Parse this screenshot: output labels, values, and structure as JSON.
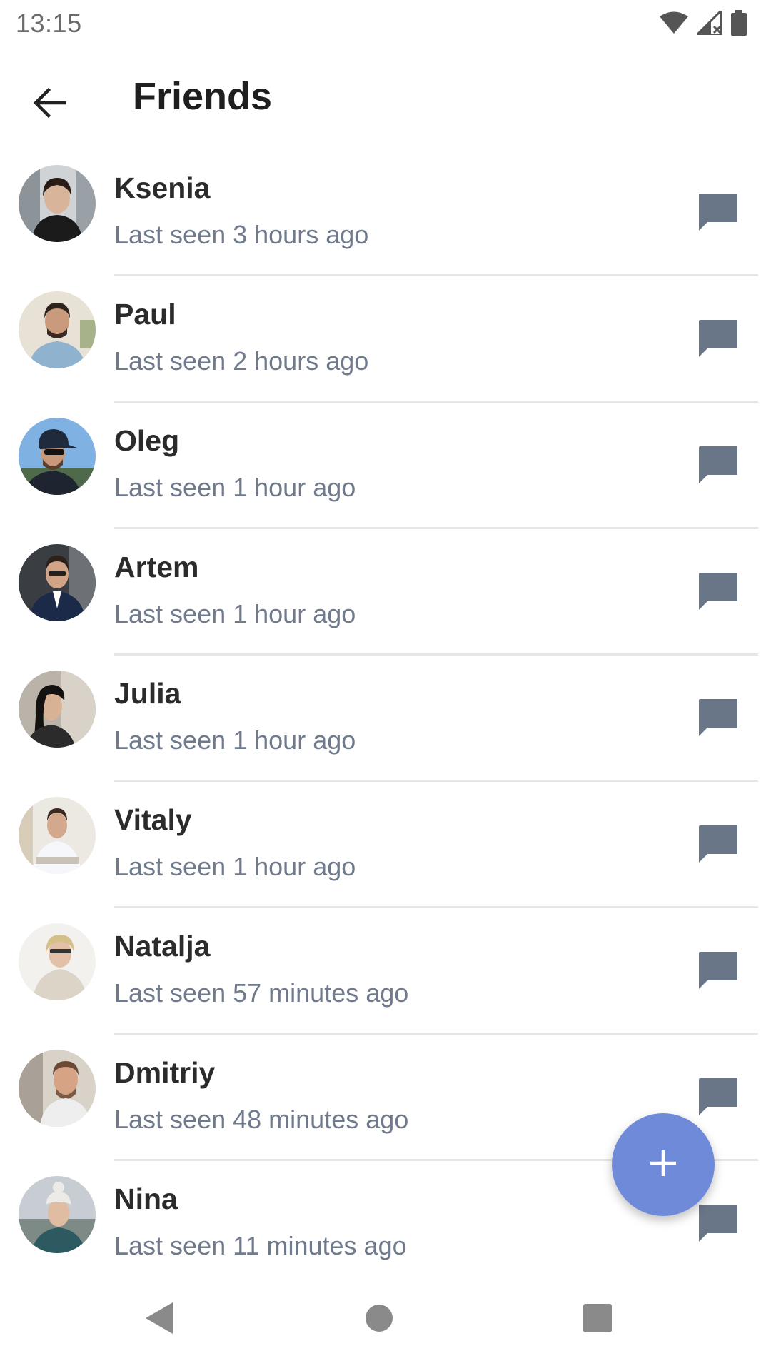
{
  "status_bar": {
    "time": "13:15",
    "icons": [
      "wifi-icon",
      "signal-icon",
      "battery-icon"
    ]
  },
  "app_bar": {
    "back_icon": "arrow-back-icon",
    "title": "Friends"
  },
  "friends": [
    {
      "name": "Ksenia",
      "last_seen": "Last seen 3 hours ago"
    },
    {
      "name": "Paul",
      "last_seen": "Last seen 2 hours ago"
    },
    {
      "name": "Oleg",
      "last_seen": "Last seen 1 hour ago"
    },
    {
      "name": "Artem",
      "last_seen": "Last seen 1 hour ago"
    },
    {
      "name": "Julia",
      "last_seen": "Last seen 1 hour ago"
    },
    {
      "name": "Vitaly",
      "last_seen": "Last seen 1 hour ago"
    },
    {
      "name": "Natalja",
      "last_seen": "Last seen 57 minutes ago"
    },
    {
      "name": "Dmitriy",
      "last_seen": "Last seen 48 minutes ago"
    },
    {
      "name": "Nina",
      "last_seen": "Last seen 11 minutes ago"
    }
  ],
  "fab": {
    "icon": "plus-icon"
  },
  "nav_bar": {
    "icons": [
      "nav-back-icon",
      "nav-home-icon",
      "nav-recents-icon"
    ]
  },
  "colors": {
    "accent": "#6f8ad9",
    "name_text": "#2b2b2b",
    "secondary_text": "#6f7a8c",
    "chat_icon": "#687688",
    "divider": "#e6e6e6"
  }
}
